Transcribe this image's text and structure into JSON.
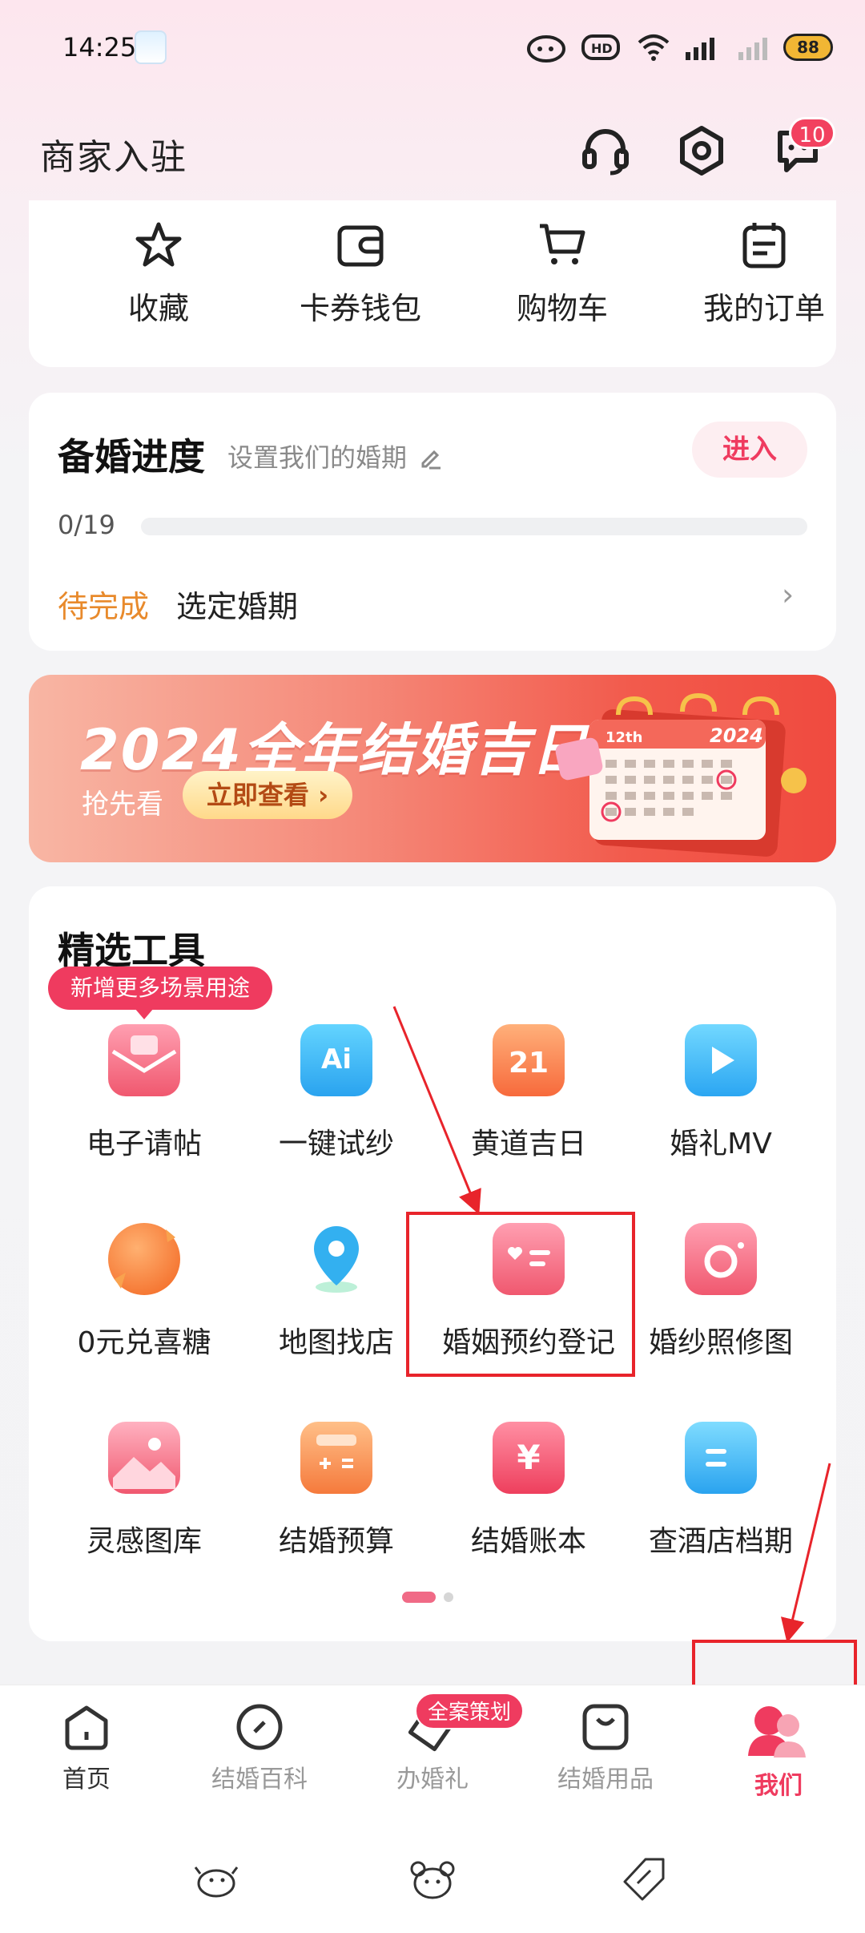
{
  "status_bar": {
    "time": "14:25",
    "battery": "88"
  },
  "header": {
    "merchant_label": "商家入驻",
    "message_badge": "10"
  },
  "quick_actions": [
    {
      "label": "收藏",
      "icon": "star-icon"
    },
    {
      "label": "卡券钱包",
      "icon": "wallet-icon"
    },
    {
      "label": "购物车",
      "icon": "cart-icon"
    },
    {
      "label": "我的订单",
      "icon": "order-icon"
    }
  ],
  "progress": {
    "title": "备婚进度",
    "subtitle": "设置我们的婚期",
    "enter_label": "进入",
    "count": "0/19",
    "fraction": 0,
    "pending_label": "待完成",
    "task": "选定婚期"
  },
  "banner": {
    "title": "2024全年结婚吉日",
    "sub": "抢先看",
    "button": "立即查看",
    "calendar_year": "2024",
    "calendar_month": "12th"
  },
  "tools": {
    "title": "精选工具",
    "tag": "新增更多场景用途",
    "items": [
      {
        "label": "电子请帖",
        "icon": "envelope-icon",
        "icon_text": ""
      },
      {
        "label": "一键试纱",
        "icon": "ai-icon",
        "icon_text": "Ai"
      },
      {
        "label": "黄道吉日",
        "icon": "calendar-21-icon",
        "icon_text": "21"
      },
      {
        "label": "婚礼MV",
        "icon": "video-icon",
        "icon_text": ""
      },
      {
        "label": "0元兑喜糖",
        "icon": "candy-icon",
        "icon_text": ""
      },
      {
        "label": "地图找店",
        "icon": "map-pin-icon",
        "icon_text": ""
      },
      {
        "label": "婚姻预约登记",
        "icon": "marriage-card-icon",
        "icon_text": ""
      },
      {
        "label": "婚纱照修图",
        "icon": "camera-icon",
        "icon_text": ""
      },
      {
        "label": "灵感图库",
        "icon": "gallery-icon",
        "icon_text": ""
      },
      {
        "label": "结婚预算",
        "icon": "calculator-icon",
        "icon_text": ""
      },
      {
        "label": "结婚账本",
        "icon": "ledger-icon",
        "icon_text": "¥"
      },
      {
        "label": "查酒店档期",
        "icon": "hotel-schedule-icon",
        "icon_text": ""
      }
    ]
  },
  "bottom_nav": {
    "items": [
      {
        "label": "首页",
        "icon": "home-icon"
      },
      {
        "label": "结婚百科",
        "icon": "compass-icon"
      },
      {
        "label": "办婚礼",
        "icon": "wedding-tag-icon"
      },
      {
        "label": "结婚用品",
        "icon": "bag-icon"
      },
      {
        "label": "我们",
        "icon": "couple-icon"
      }
    ],
    "plan_badge": "全案策划"
  },
  "colors": {
    "accent": "#ef3b5f",
    "pending": "#e88a2c",
    "annotation": "#e8242b"
  }
}
